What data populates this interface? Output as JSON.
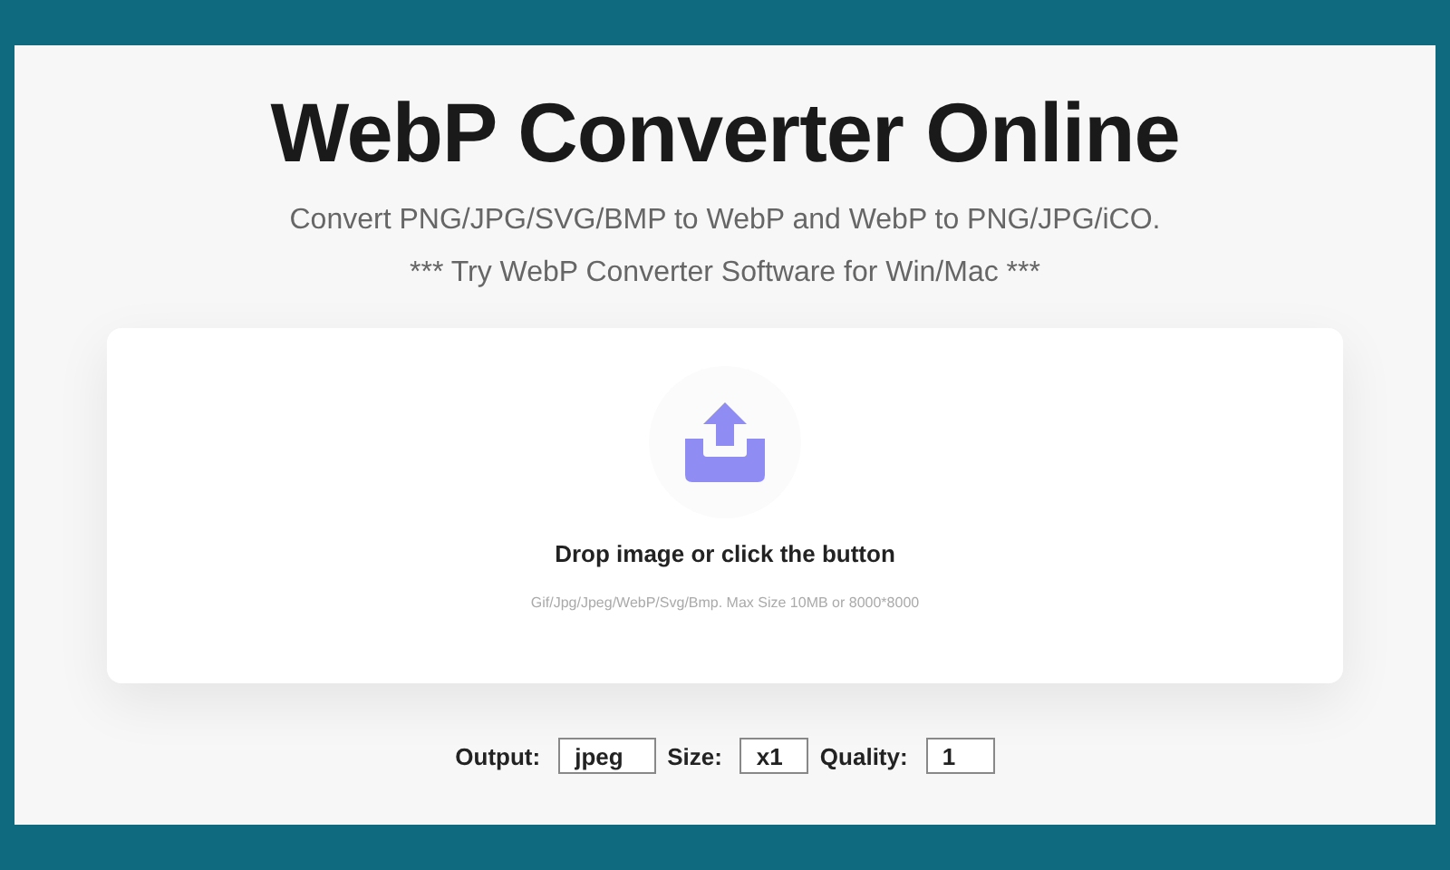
{
  "title": "WebP Converter Online",
  "subtitle": "Convert PNG/JPG/SVG/BMP to WebP and WebP to PNG/JPG/iCO.",
  "promo_link": "*** Try WebP Converter Software for Win/Mac ***",
  "dropzone": {
    "label": "Drop image or click the button",
    "hint": "Gif/Jpg/Jpeg/WebP/Svg/Bmp. Max Size 10MB or 8000*8000"
  },
  "options": [
    {
      "label": "Output:",
      "value": "jpeg"
    },
    {
      "label": "Size:",
      "value": "x1"
    },
    {
      "label": "Quality:",
      "value": "1"
    }
  ]
}
